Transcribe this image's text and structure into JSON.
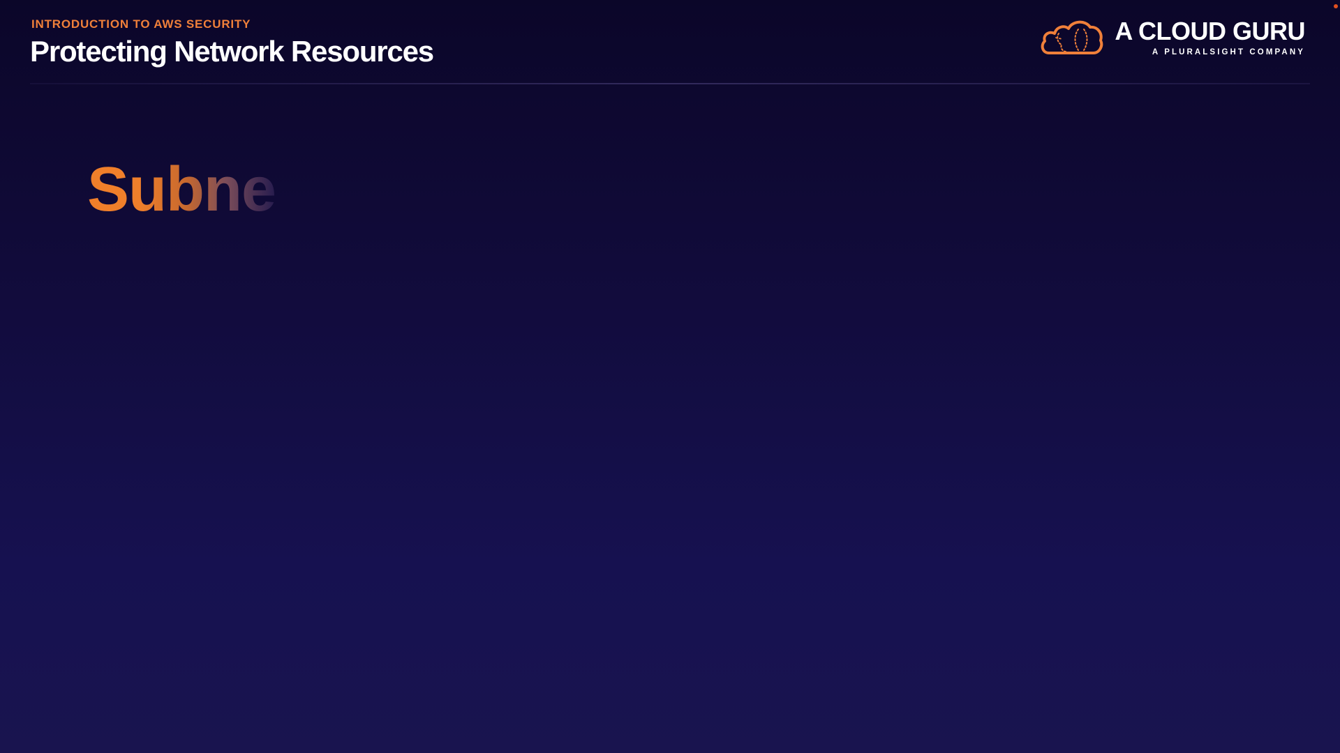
{
  "slide": {
    "course_label": "INTRODUCTION TO AWS SECURITY",
    "heading": "Protecting Network Resources",
    "section_title": "Subne"
  },
  "branding": {
    "name": "A CLOUD GURU",
    "tagline": "A PLURALSIGHT COMPANY",
    "icon": "cloud-logo-icon"
  },
  "colors": {
    "accent": "#f0803a",
    "background_top": "#0b0629",
    "background_bottom": "#19144f",
    "text": "#ffffff"
  }
}
